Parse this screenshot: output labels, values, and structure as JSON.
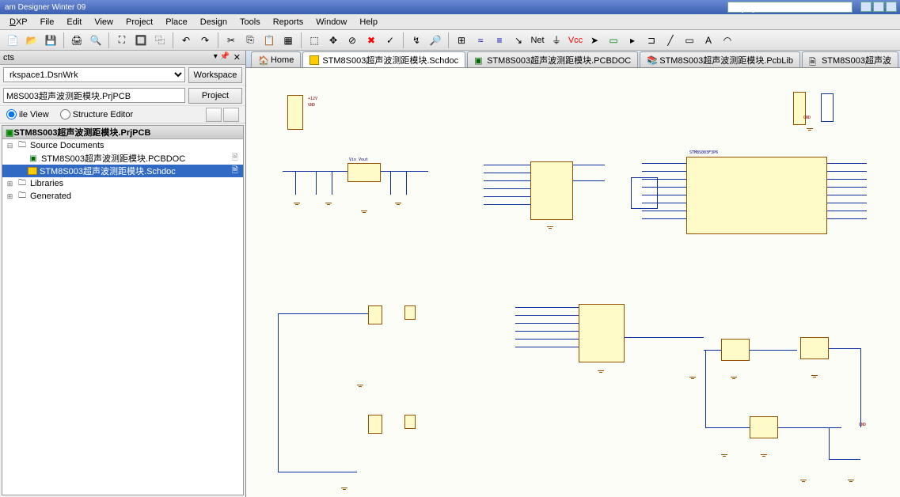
{
  "title_left": "am Designer Winter 09",
  "title_right": "D:\\[07]技术创新\\设计资源\\STM8S",
  "pathbox": "D:\\[07]技术创新\\设计资源\\STM8S",
  "menu": {
    "dxp": "DXP",
    "file": "File",
    "edit": "Edit",
    "view": "View",
    "project": "Project",
    "place": "Place",
    "design": "Design",
    "tools": "Tools",
    "reports": "Reports",
    "window": "Window",
    "help": "Help"
  },
  "panel": {
    "title": "cts",
    "ws": "rkspace1.DsnWrk",
    "ws_btn": "Workspace",
    "prj_val": "M8S003超声波测距模块.PrjPCB",
    "prj_btn": "Project",
    "view_file": "ile View",
    "view_struct": "Structure Editor"
  },
  "tree": {
    "root": "STM8S003超声波测距模块.PrjPCB",
    "src": "Source Documents",
    "doc1": "STM8S003超声波测距模块.PCBDOC",
    "doc2": "STM8S003超声波测距模块.Schdoc",
    "libs": "Libraries",
    "gen": "Generated"
  },
  "tabs": {
    "home": "Home",
    "t1": "STM8S003超声波测距模块.Schdoc",
    "t2": "STM8S003超声波测距模块.PCBDOC",
    "t3": "STM8S003超声波测距模块.PcbLib",
    "t4": "STM8S003超声波"
  },
  "toolbar_labels": {
    "net": "Net",
    "vcc": "Vcc"
  }
}
